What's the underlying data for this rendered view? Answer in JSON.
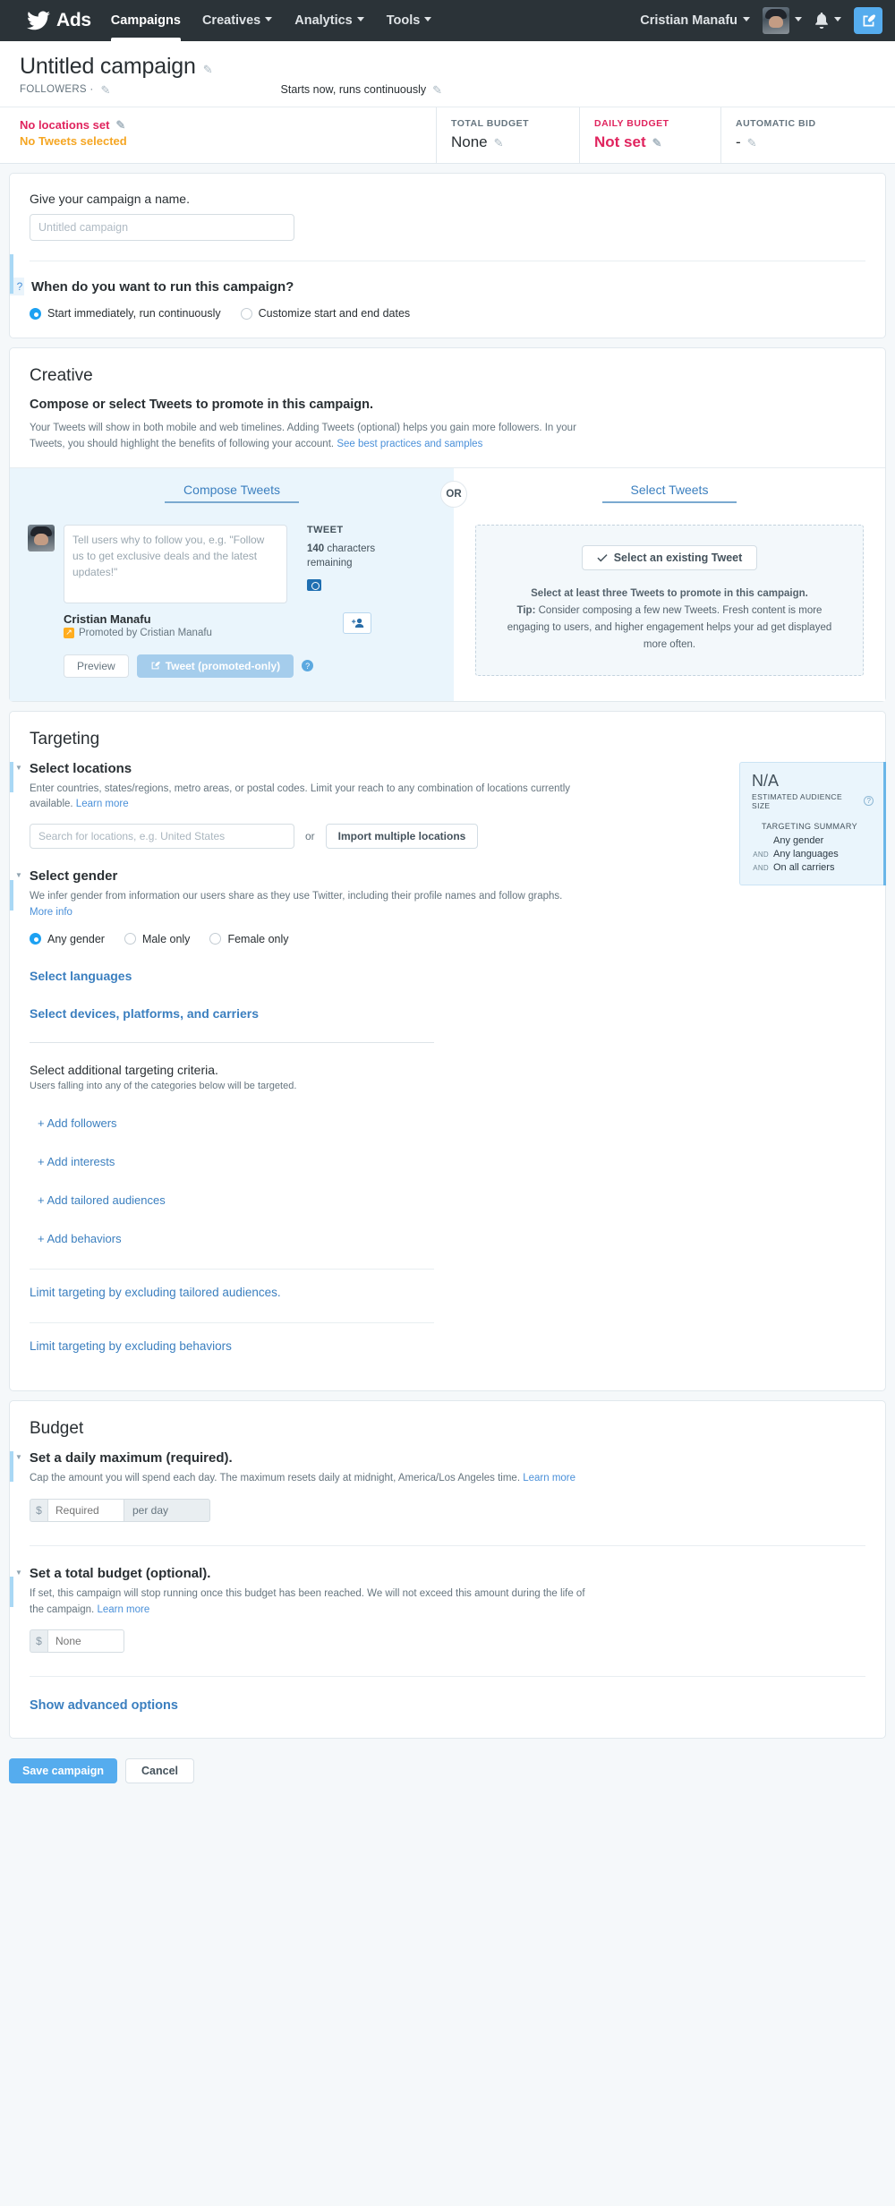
{
  "nav": {
    "brand_label": "Ads",
    "items": [
      {
        "label": "Campaigns",
        "has_caret": false
      },
      {
        "label": "Creatives",
        "has_caret": true
      },
      {
        "label": "Analytics",
        "has_caret": true
      },
      {
        "label": "Tools",
        "has_caret": true
      }
    ],
    "user_name": "Cristian Manafu"
  },
  "campaign_header": {
    "title": "Untitled campaign",
    "objective": "FOLLOWERS ·",
    "schedule": "Starts now, runs continuously",
    "alert_locations": "No locations set",
    "alert_tweets": "No Tweets selected",
    "total_budget_label": "TOTAL BUDGET",
    "total_budget_value": "None",
    "daily_budget_label": "DAILY BUDGET",
    "daily_budget_value": "Not set",
    "bid_label": "AUTOMATIC BID",
    "bid_value": "-"
  },
  "name_card": {
    "field_label": "Give your campaign a name.",
    "name_placeholder": "Untitled campaign",
    "schedule_question": "When do you want to run this campaign?",
    "help_marker": "?",
    "option_immediate": "Start immediately, run continuously",
    "option_custom": "Customize start and end dates"
  },
  "creative": {
    "title": "Creative",
    "heading": "Compose or select Tweets to promote in this campaign.",
    "description": "Your Tweets will show in both mobile and web timelines. Adding Tweets (optional) helps you gain more followers. In your Tweets, you should highlight the benefits of following your account.",
    "description_link": "See best practices and samples",
    "compose_tab": "Compose Tweets",
    "select_tab": "Select Tweets",
    "or_badge": "OR",
    "composer_placeholder": "Tell users why to follow you, e.g. \"Follow us to get exclusive deals and the latest updates!\"",
    "tweet_label": "TWEET",
    "char_count": "140",
    "char_count_rest": " characters remaining",
    "account_name": "Cristian Manafu",
    "promoted_by": "Promoted by Cristian Manafu",
    "preview_button": "Preview",
    "tweet_button": "Tweet (promoted-only)",
    "select_existing_button": "Select an existing Tweet",
    "select_note_bold": "Select at least three Tweets to promote in this campaign.",
    "select_note_tip_label": "Tip:",
    "select_note_tip": " Consider composing a few new Tweets. Fresh content is more engaging to users, and higher engagement helps your ad get displayed more often."
  },
  "targeting": {
    "title": "Targeting",
    "locations_heading": "Select locations",
    "locations_desc": "Enter countries, states/regions, metro areas, or postal codes. Limit your reach to any combination of locations currently available.",
    "locations_link": "Learn more",
    "locations_placeholder": "Search for locations, e.g. United States",
    "or_text": "or",
    "import_button": "Import multiple locations",
    "gender_heading": "Select gender",
    "gender_desc": "We infer gender from information our users share as they use Twitter, including their profile names and follow graphs.",
    "gender_link": "More info",
    "gender_any": "Any gender",
    "gender_male": "Male only",
    "gender_female": "Female only",
    "languages_link": "Select languages",
    "devices_link": "Select devices, platforms, and carriers",
    "criteria_title": "Select additional targeting criteria.",
    "criteria_sub": "Users falling into any of the categories below will be targeted.",
    "add_links": [
      "+ Add followers",
      "+ Add interests",
      "+ Add tailored audiences",
      "+ Add behaviors"
    ],
    "limit_tailored": "Limit targeting by excluding tailored audiences.",
    "limit_behaviors": "Limit targeting by excluding behaviors",
    "estimate": {
      "value": "N/A",
      "label": "ESTIMATED AUDIENCE SIZE",
      "help": "?",
      "summary_title": "TARGETING SUMMARY",
      "rows": [
        {
          "and": "",
          "text": "Any gender"
        },
        {
          "and": "AND",
          "text": "Any languages"
        },
        {
          "and": "AND",
          "text": "On all carriers"
        }
      ]
    }
  },
  "budget": {
    "title": "Budget",
    "daily_heading": "Set a daily maximum (required).",
    "daily_desc": "Cap the amount you will spend each day. The maximum resets daily at midnight, America/Los Angeles time.",
    "daily_link": "Learn more",
    "currency_symbol": "$",
    "daily_placeholder": "Required",
    "per_day": "per day",
    "total_heading": "Set a total budget (optional).",
    "total_desc": "If set, this campaign will stop running once this budget has been reached. We will not exceed this amount during the life of the campaign.",
    "total_link": "Learn more",
    "total_placeholder": "None",
    "advanced_link": "Show advanced options"
  },
  "footer": {
    "save_label": "Save campaign",
    "cancel_label": "Cancel"
  }
}
